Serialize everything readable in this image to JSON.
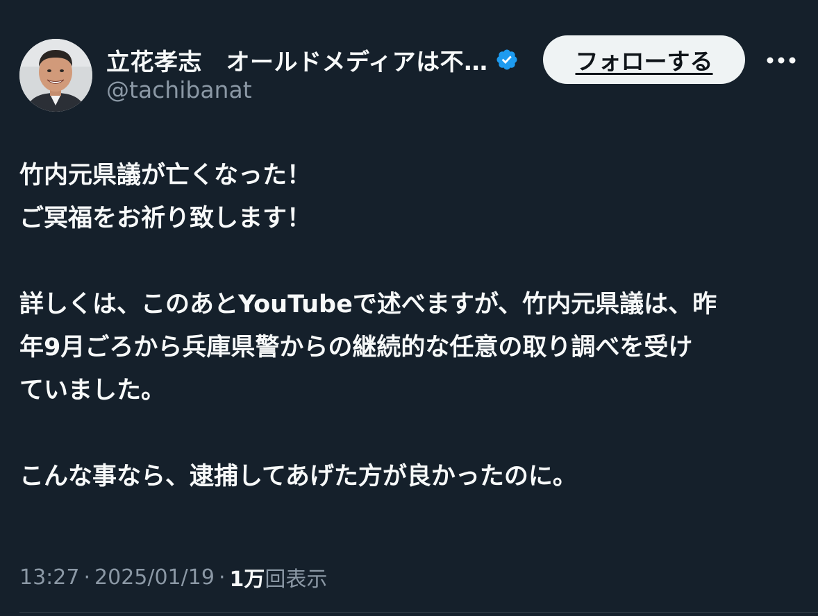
{
  "author": {
    "display_name": "立花孝志　オールドメディアは不…",
    "handle": "@tachibanat",
    "verified": true,
    "avatar_icon": "profile-photo"
  },
  "actions": {
    "follow_label": "フォローする",
    "more_icon": "more-horizontal-icon"
  },
  "tweet": {
    "lines": [
      "竹内元県議が亡くなった！",
      "ご冥福をお祈り致します！",
      "",
      "詳しくは、このあとYouTubeで述べますが、竹内元県議は、昨",
      "年9月ごろから兵庫県警からの継続的な任意の取り調べを受け",
      "ていました。",
      "",
      "こんな事なら、逮捕してあげた方が良かったのに。"
    ]
  },
  "meta": {
    "time": "13:27",
    "date": "2025/01/19",
    "separator": "·",
    "views_count": "1万",
    "views_label": "回表示"
  },
  "colors": {
    "background": "#15202b",
    "text_primary": "#f7f9f9",
    "text_secondary": "#8b98a5",
    "verified_badge": "#1d9bf0",
    "follow_button_bg": "#eff3f4"
  }
}
